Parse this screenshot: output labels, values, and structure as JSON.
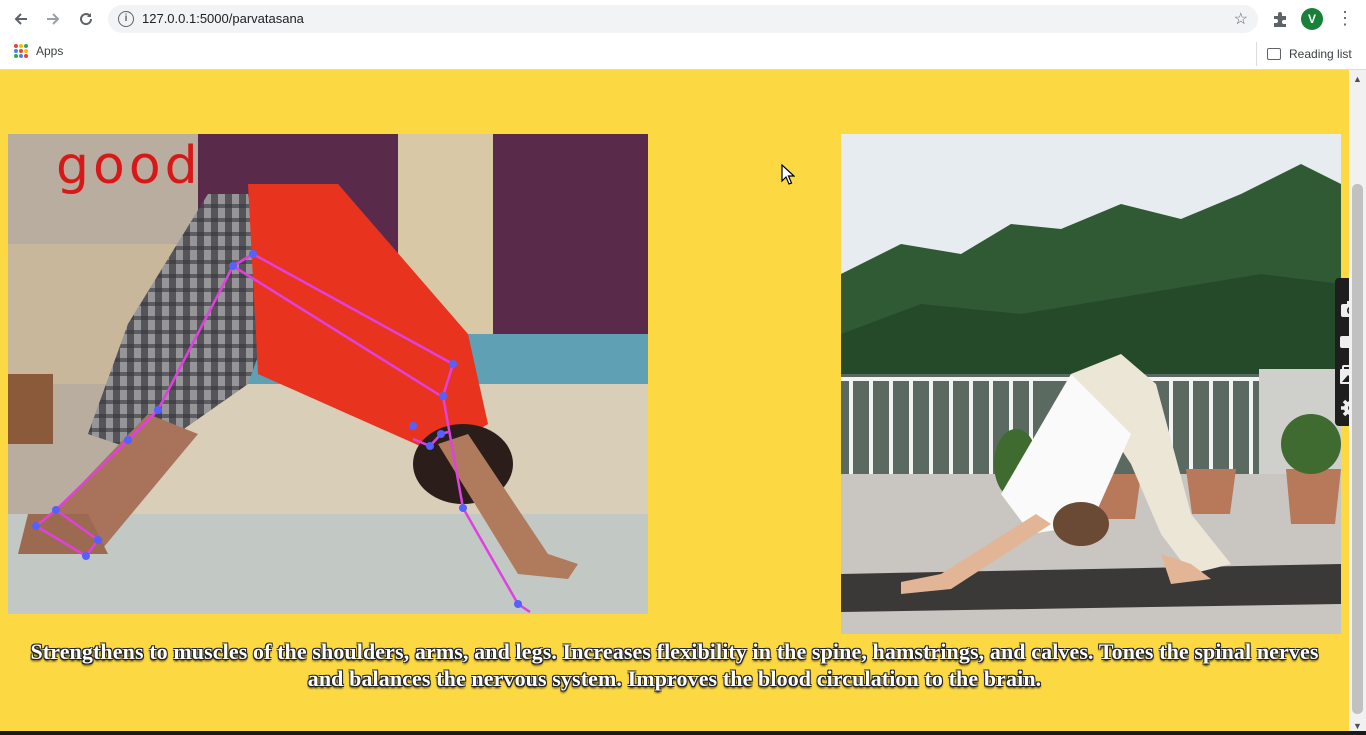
{
  "browser": {
    "url": "127.0.0.1:5000/parvatasana",
    "avatar_letter": "V",
    "bookmarks": {
      "apps_label": "Apps",
      "reading_list_label": "Reading list"
    }
  },
  "page": {
    "background_color": "#fcd842",
    "feedback_text": "good",
    "caption": "Strengthens to muscles of the shoulders, arms, and legs. Increases flexibility in the spine, hamstrings, and calves. Tones the spinal nerves and balances the nervous system. Improves the blood circulation to the brain."
  },
  "icons": [
    "back-icon",
    "forward-icon",
    "reload-icon",
    "info-icon",
    "bookmark-star-icon",
    "extensions-icon",
    "menu-icon",
    "apps-icon",
    "reading-list-icon",
    "camera-icon",
    "video-icon",
    "gallery-icon",
    "settings-icon",
    "cursor-icon"
  ]
}
